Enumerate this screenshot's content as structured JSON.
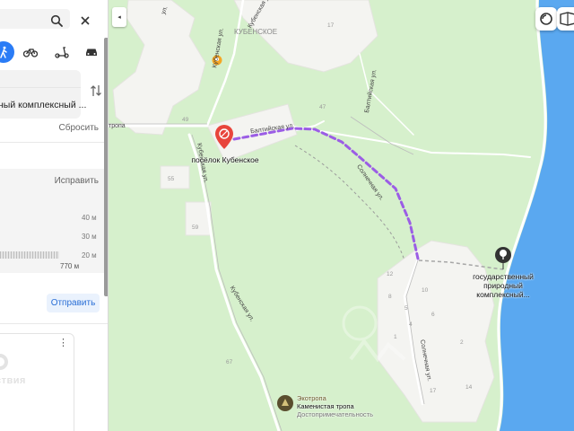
{
  "panel": {
    "search": {
      "value": "",
      "placeholder": ""
    },
    "transport": [
      "walk",
      "bicycle",
      "scooter",
      "car"
    ],
    "route": {
      "destination": "ный комплексный ..."
    },
    "reset_label": "Сбросить",
    "elevation": {
      "fix_label": "Исправить",
      "ticks": [
        "40 м",
        "30 м",
        "20 м"
      ],
      "distance": "770 м"
    },
    "send_label": "Отправить",
    "promo": {
      "text": "ствия",
      "menu": "⋮"
    }
  },
  "map": {
    "collapse_label": "◂",
    "area_label": "КУБЕНСКОЕ",
    "start_label": "посёлок Кубенское",
    "end_label_lines": [
      "государственный",
      "природный",
      "комплексный..."
    ],
    "poi": {
      "line1": "Экотропа",
      "line2": "Каменистая тропа",
      "line3": "Достопримечательность"
    },
    "streets": {
      "baltiyskaya1": "Балтийская ул.",
      "baltiyskaya2": "Балтийская ул.",
      "kubenskaya1": "Кубенская ул.",
      "kubenskaya2": "Кубенская ул.",
      "kubenskaya3": "Кубенская ул.",
      "kubenskaya4": "Кубенская ул.",
      "solnechnaya1": "Солнечная ул.",
      "solnechnaya2": "Солнечная ул.",
      "tropa": "тропа",
      "ul": "ул."
    },
    "buildings": [
      "17",
      "47",
      "49",
      "55",
      "59",
      "67",
      "12",
      "10",
      "8",
      "5",
      "6",
      "4",
      "1",
      "17",
      "14",
      "2"
    ],
    "colors": {
      "land": "#d6f0cc",
      "water": "#5aa8f0",
      "route": "#9b5de5",
      "marker_start": "#e8453c"
    }
  }
}
